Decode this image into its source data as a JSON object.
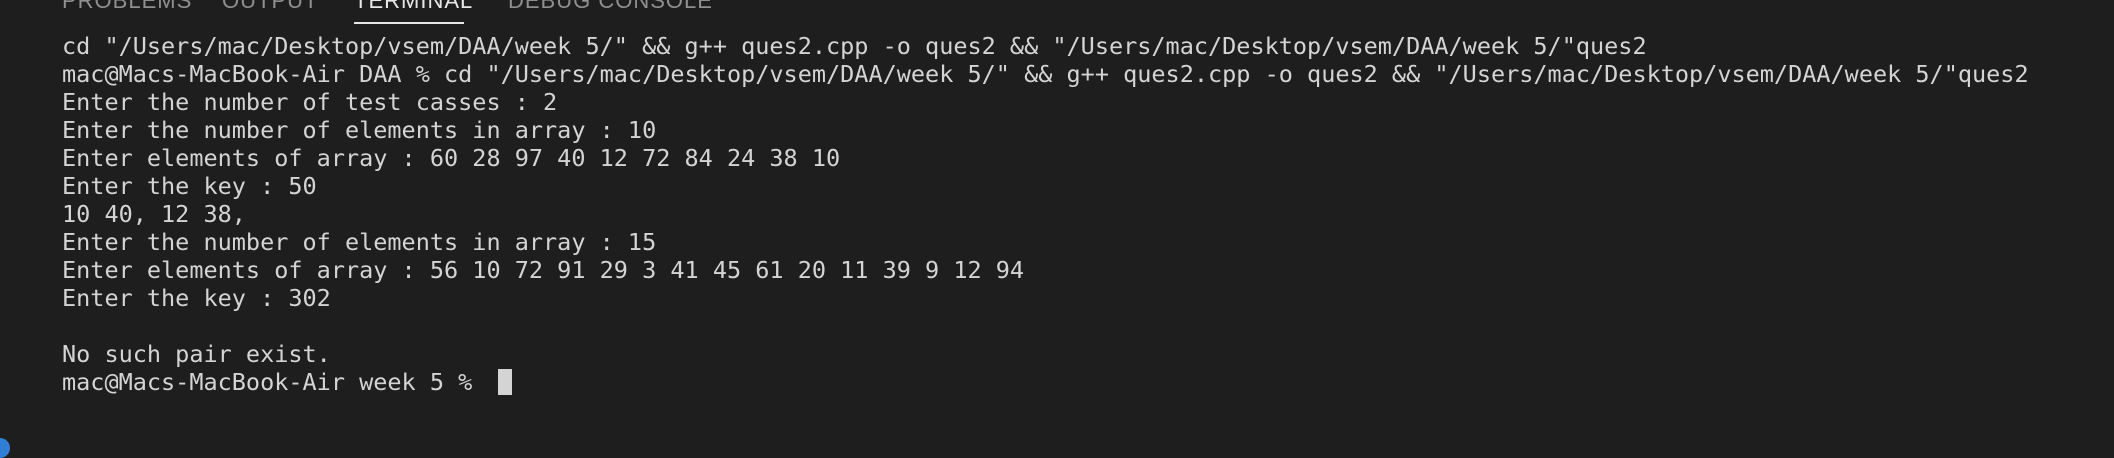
{
  "panel": {
    "tabs": [
      {
        "label": "PROBLEMS"
      },
      {
        "label": "OUTPUT"
      },
      {
        "label": "TERMINAL"
      },
      {
        "label": "DEBUG CONSOLE"
      }
    ],
    "active_tab": "TERMINAL"
  },
  "terminal": {
    "lines": [
      "cd \"/Users/mac/Desktop/vsem/DAA/week 5/\" && g++ ques2.cpp -o ques2 && \"/Users/mac/Desktop/vsem/DAA/week 5/\"ques2",
      "mac@Macs-MacBook-Air DAA % cd \"/Users/mac/Desktop/vsem/DAA/week 5/\" && g++ ques2.cpp -o ques2 && \"/Users/mac/Desktop/vsem/DAA/week 5/\"ques2",
      "Enter the number of test casses : 2",
      "Enter the number of elements in array : 10",
      "Enter elements of array : 60 28 97 40 12 72 84 24 38 10",
      "Enter the key : 50",
      "10 40, 12 38,",
      "Enter the number of elements in array : 15",
      "Enter elements of array : 56 10 72 91 29 3 41 45 61 20 11 39 9 12 94",
      "Enter the key : 302",
      "",
      "No such pair exist.",
      "mac@Macs-MacBook-Air week 5 % "
    ]
  },
  "colors": {
    "background": "#1e1e1e",
    "text": "#d4d4d4",
    "inactive_tab": "#8f8f8f",
    "active_tab": "#e7e7e7",
    "accent": "#2f7fd6"
  }
}
